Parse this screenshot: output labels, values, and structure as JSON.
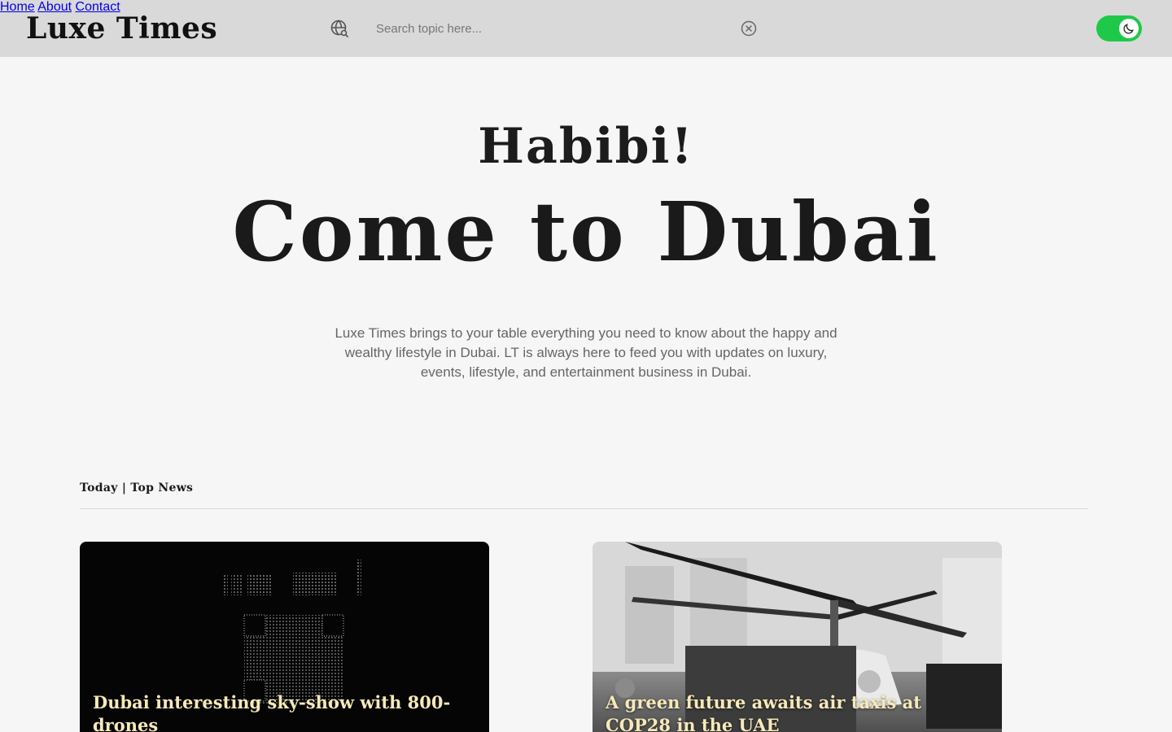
{
  "header": {
    "logo": "Luxe Times",
    "search_placeholder": "Search topic here...",
    "nav": [
      {
        "label": "Home"
      },
      {
        "label": "About"
      },
      {
        "label": "Contact"
      }
    ],
    "theme_toggle": {
      "state": "on",
      "accent": "#1ec94a"
    }
  },
  "hero": {
    "kicker": "Habibi!",
    "title": "Come to Dubai",
    "description": "Luxe Times brings to your table everything you need to know about the happy and wealthy lifestyle in Dubai. LT is always here to feed you with updates on luxury, events, lifestyle, and entertainment business in Dubai."
  },
  "section": {
    "label": "Today | Top News"
  },
  "cards": [
    {
      "title": "Dubai interesting sky-show with 800-drones"
    },
    {
      "title": "A green future awaits air taxis at COP28 in the UAE"
    }
  ],
  "icons": {
    "search": "globe-search-icon",
    "clear": "close-circle-icon",
    "theme": "moon-icon"
  }
}
